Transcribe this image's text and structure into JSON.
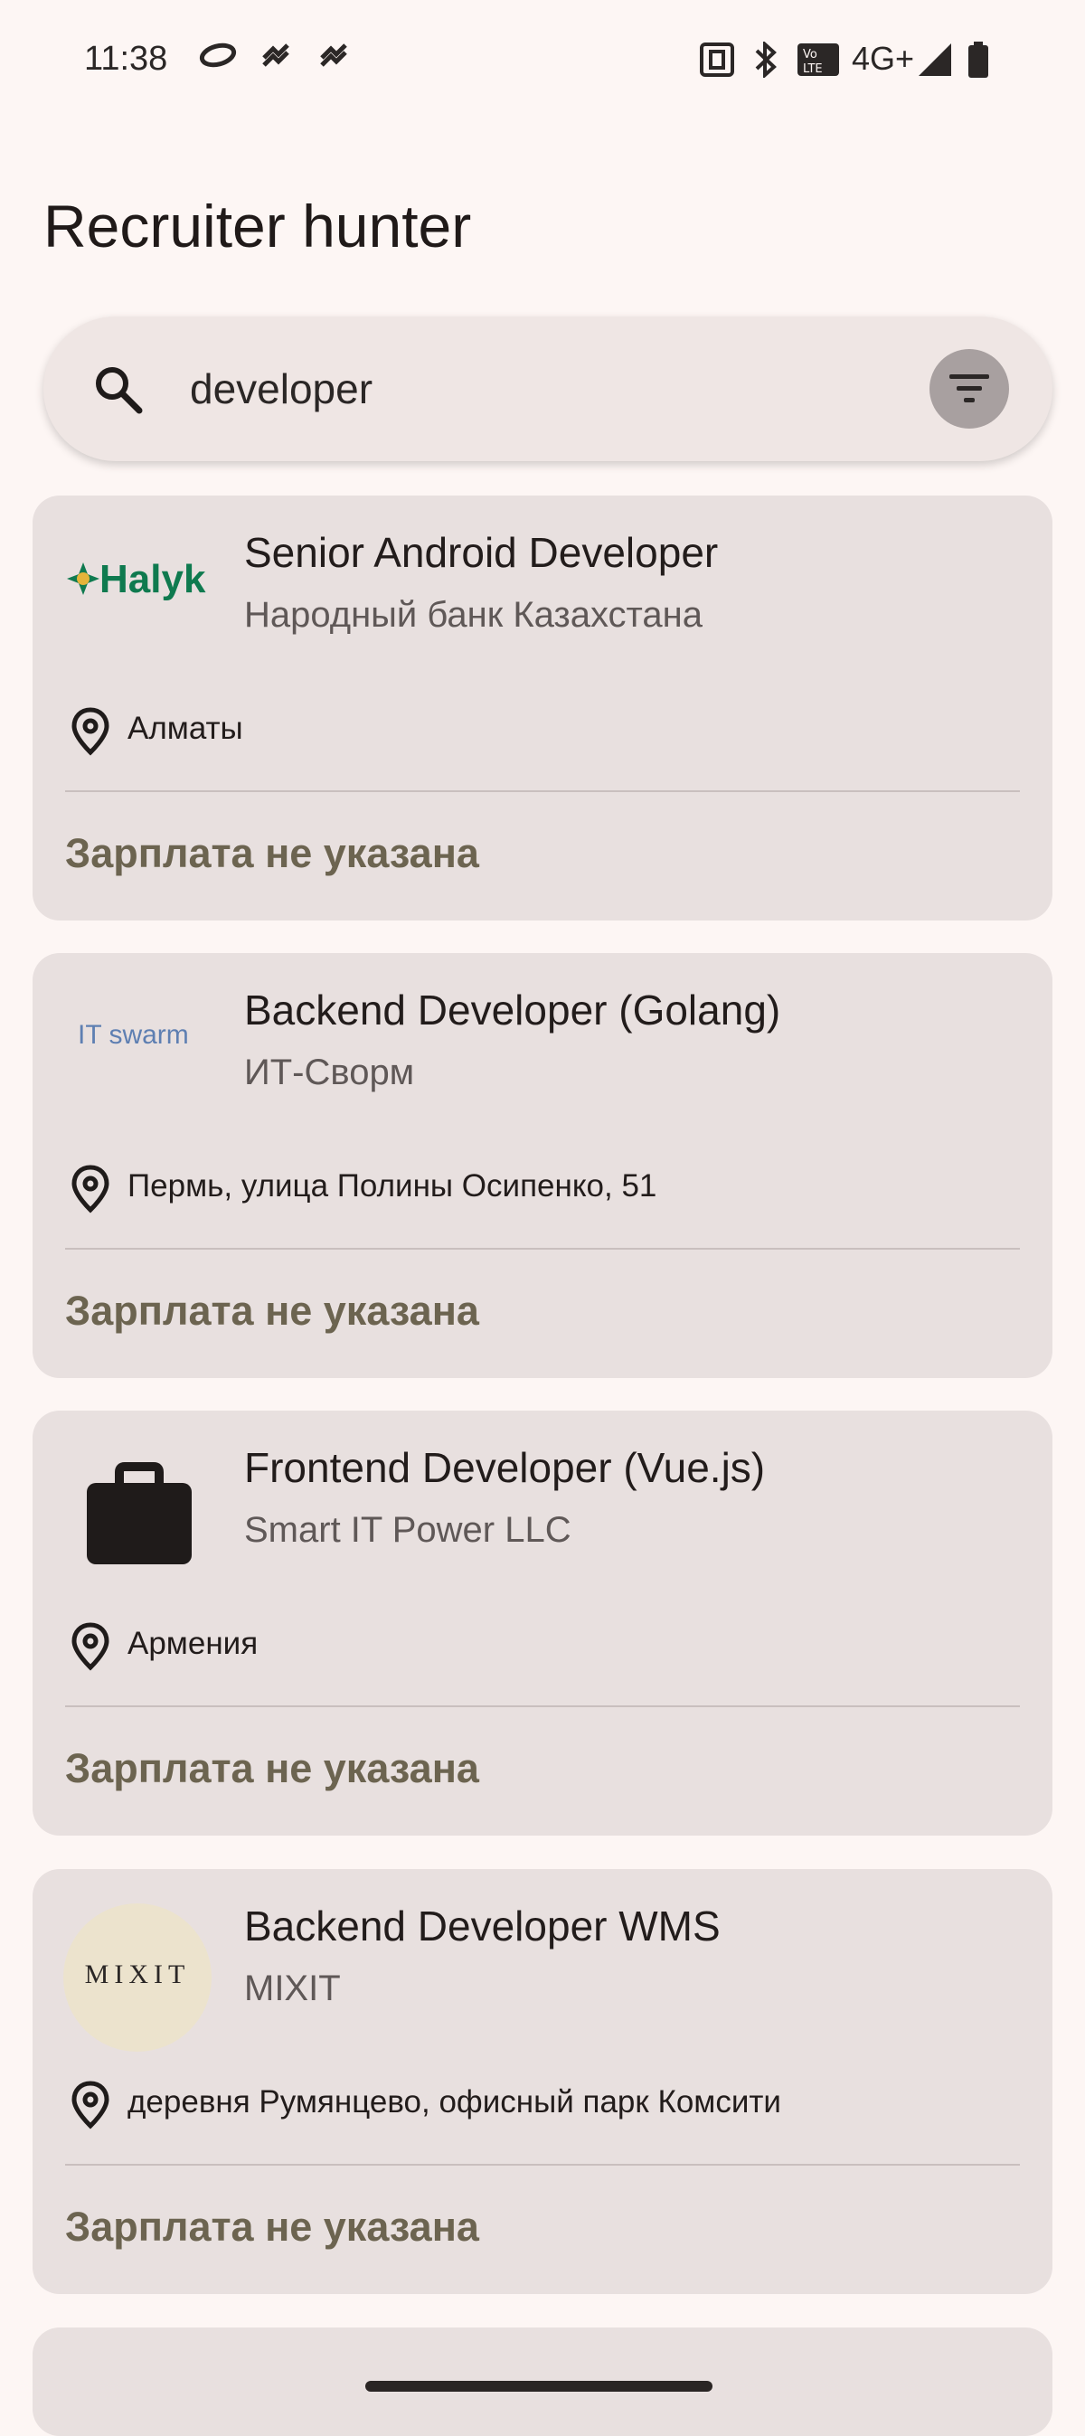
{
  "status_bar": {
    "time": "11:38",
    "network_label": "4G+",
    "icons": [
      "sync-icon",
      "notification-icon",
      "notification-icon",
      "nfc-icon",
      "bluetooth-icon",
      "volte-icon",
      "signal-icon",
      "battery-icon"
    ]
  },
  "header": {
    "title": "Recruiter hunter"
  },
  "search": {
    "query": "developer"
  },
  "jobs": [
    {
      "title": "Senior Android Developer",
      "company": "Народный банк Казахстана",
      "location": "Алматы",
      "salary": "Зарплата не указана",
      "logo_text": "Halyk"
    },
    {
      "title": "Backend Developer (Golang)",
      "company": "ИТ-Сворм",
      "location": "Пермь, улица Полины Осипенко, 51",
      "salary": "Зарплата не указана",
      "logo_text": "IT swarm"
    },
    {
      "title": "Frontend Developer (Vue.js)",
      "company": "Smart IT Power LLC",
      "location": "Армения",
      "salary": "Зарплата не указана",
      "logo_icon": "briefcase-icon"
    },
    {
      "title": "Backend Developer WMS",
      "company": "MIXIT",
      "location": "деревня Румянцево, офисный парк Комсити",
      "salary": "Зарплата не указана",
      "logo_text": "MIXIT"
    }
  ],
  "colors": {
    "background": "#fdf6f4",
    "card": "#e8e0df",
    "salary": "#6c6450",
    "halyk_green": "#0f7a4f"
  }
}
